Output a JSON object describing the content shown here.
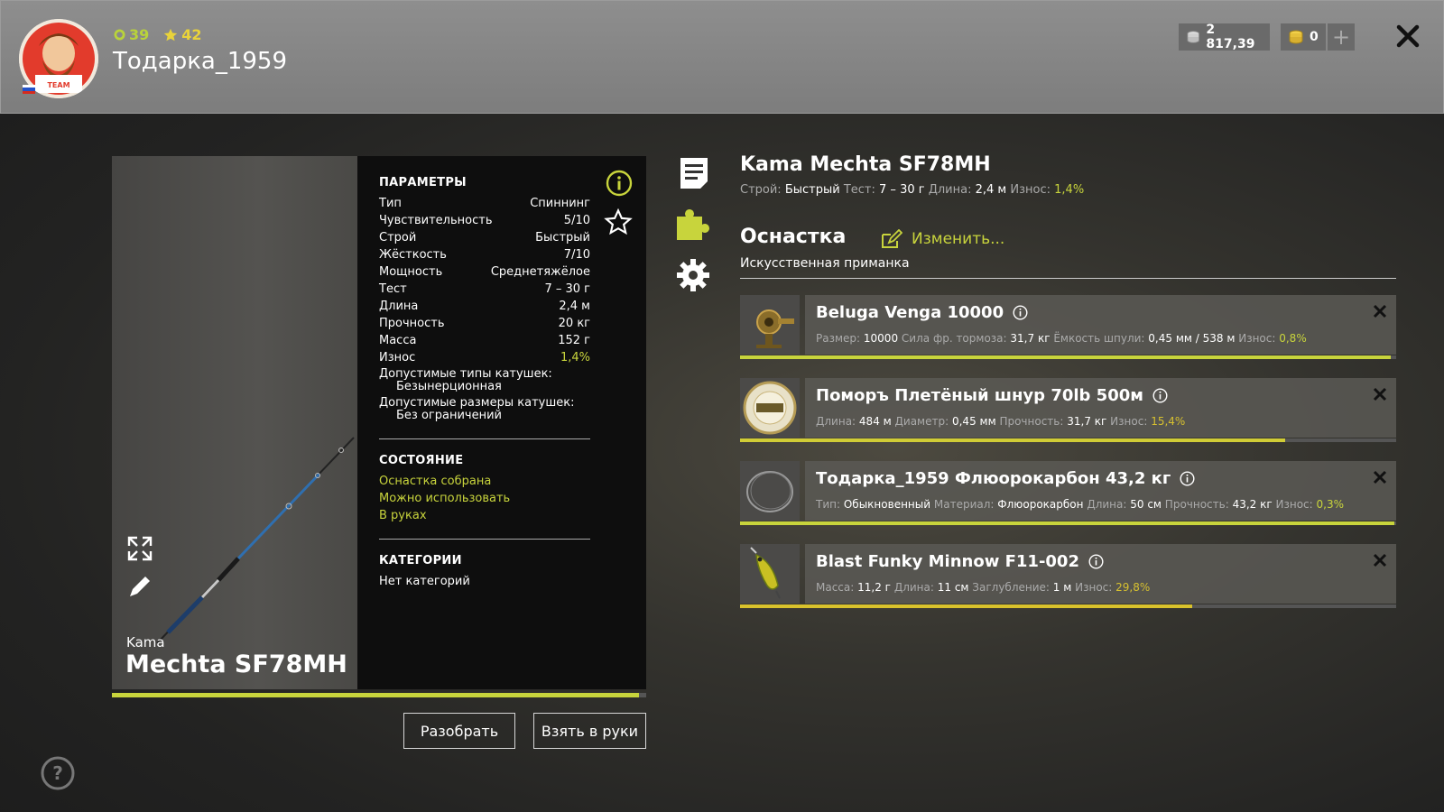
{
  "player": {
    "username": "Тодарка_1959",
    "level": "39",
    "rank": "42"
  },
  "currency": {
    "silver": "2 817,39",
    "gold": "0",
    "add_label": "+"
  },
  "rod": {
    "brand": "Kama",
    "model": "Mechta SF78MH",
    "title": "Kama Mechta SF78MH",
    "wear_fraction": 0.986,
    "summary": [
      {
        "label": "Строй:",
        "value": "Быстрый"
      },
      {
        "label": "Тест:",
        "value": "7 – 30 г"
      },
      {
        "label": "Длина:",
        "value": "2,4 м"
      },
      {
        "label": "Износ:",
        "value": "1,4%"
      }
    ]
  },
  "params": {
    "title": "ПАРАМЕТРЫ",
    "rows": [
      {
        "label": "Тип",
        "value": "Спиннинг"
      },
      {
        "label": "Чувствительность",
        "value": "5/10"
      },
      {
        "label": "Строй",
        "value": "Быстрый"
      },
      {
        "label": "Жёсткость",
        "value": "7/10"
      },
      {
        "label": "Мощность",
        "value": "Среднетяжёлое"
      },
      {
        "label": "Тест",
        "value": "7 – 30 г"
      },
      {
        "label": "Длина",
        "value": "2,4 м"
      },
      {
        "label": "Прочность",
        "value": "20 кг"
      },
      {
        "label": "Масса",
        "value": "152 г"
      },
      {
        "label": "Износ",
        "value": "1,4%"
      }
    ],
    "reel_types_label": "Допустимые типы катушек:",
    "reel_types_value": "Безынерционная",
    "reel_sizes_label": "Допустимые размеры катушек:",
    "reel_sizes_value": "Без ограничений"
  },
  "status": {
    "title": "СОСТОЯНИЕ",
    "items": [
      "Оснастка собрана",
      "Можно использовать",
      "В руках"
    ]
  },
  "categories": {
    "title": "КАТЕГОРИИ",
    "value": "Нет категорий"
  },
  "buttons": {
    "disassemble": "Разобрать",
    "take": "Взять в руки"
  },
  "tackle": {
    "title": "Оснастка",
    "change": "Изменить...",
    "lure_type": "Искусственная приманка",
    "items": [
      {
        "name": "Beluga Venga 10000",
        "specs": [
          {
            "label": "Размер:",
            "value": "10000"
          },
          {
            "label": "Сила фр. тормоза:",
            "value": "31,7 кг"
          },
          {
            "label": "Ёмкость шпули:",
            "value": "0,45 мм / 538 м"
          },
          {
            "label": "Износ:",
            "value": "0,8%"
          }
        ],
        "durability": 0.992,
        "bar_color": "#c8d43c"
      },
      {
        "name": "Поморъ Плетёный шнур 70lb 500м",
        "specs": [
          {
            "label": "Длина:",
            "value": "484 м"
          },
          {
            "label": "Диаметр:",
            "value": "0,45 мм"
          },
          {
            "label": "Прочность:",
            "value": "31,7 кг"
          },
          {
            "label": "Износ:",
            "value": "15,4%"
          }
        ],
        "durability": 0.831,
        "bar_color": "#d0cc36"
      },
      {
        "name": "Тодарка_1959 Флюорокарбон 43,2 кг",
        "specs": [
          {
            "label": "Тип:",
            "value": "Обыкновенный"
          },
          {
            "label": "Материал:",
            "value": "Флюорокарбон"
          },
          {
            "label": "Длина:",
            "value": "50 см"
          },
          {
            "label": "Прочность:",
            "value": "43,2 кг"
          },
          {
            "label": "Износ:",
            "value": "0,3%"
          }
        ],
        "durability": 0.997,
        "bar_color": "#c8d43c"
      },
      {
        "name": "Blast Funky Minnow F11-002",
        "specs": [
          {
            "label": "Масса:",
            "value": "11,2 г"
          },
          {
            "label": "Длина:",
            "value": "11 см"
          },
          {
            "label": "Заглубление:",
            "value": "1 м"
          },
          {
            "label": "Износ:",
            "value": "29,8%"
          }
        ],
        "durability": 0.689,
        "bar_color": "#d9c22c"
      }
    ]
  },
  "colors": {
    "accent": "#c8d43c",
    "gold": "#e9d33a"
  }
}
